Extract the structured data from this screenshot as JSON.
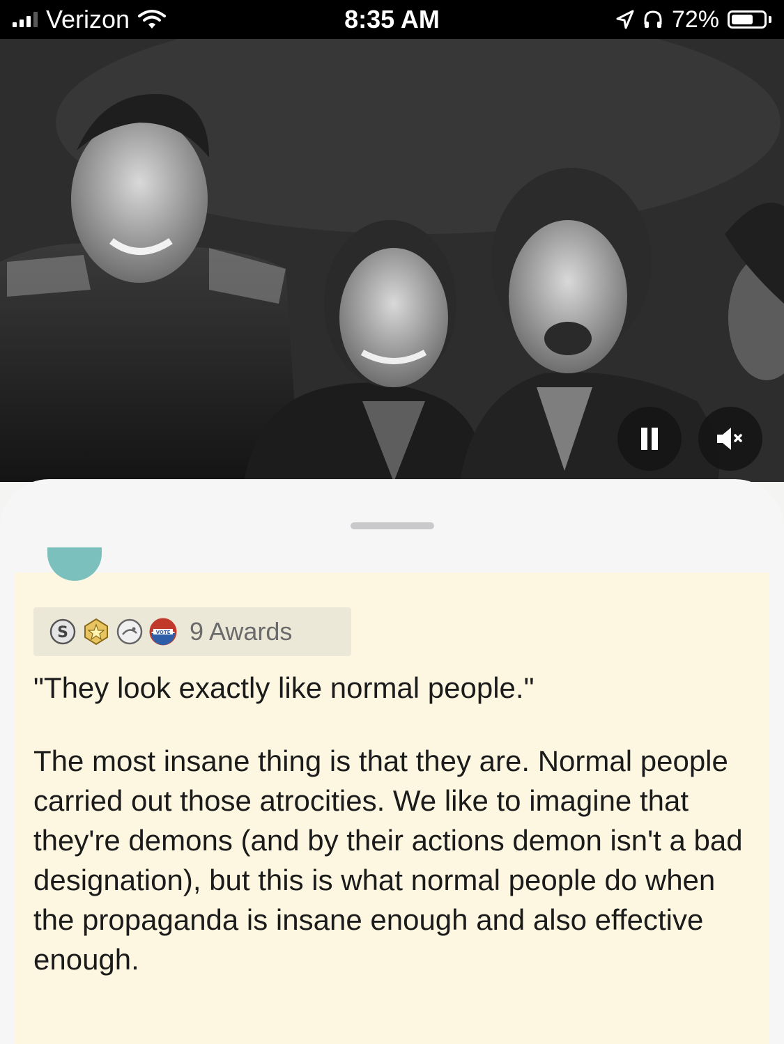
{
  "status_bar": {
    "carrier": "Verizon",
    "time": "8:35 AM",
    "battery_pct": "72%",
    "battery_level": 0.72,
    "icons": [
      "signal-icon",
      "wifi-icon",
      "location-icon",
      "headphones-icon",
      "battery-icon"
    ]
  },
  "video": {
    "controls": [
      "pause-icon",
      "mute-icon"
    ]
  },
  "comment": {
    "awards": {
      "icons": [
        "silver-award-icon",
        "gold-star-award-icon",
        "face-award-icon",
        "vote-award-icon"
      ],
      "label": "9 Awards"
    },
    "quote": "\"They look exactly like normal people.\"",
    "body": "The most insane thing is that they are.  Normal people carried out those atrocities.  We like to imagine that they're demons (and by their actions demon isn't a bad designation),  but this is what normal people do when the propaganda is insane enough and also effective enough."
  },
  "colors": {
    "status_bar_bg": "#000000",
    "sheet_bg": "#f6f6f7",
    "comment_bg": "#fdf7e1",
    "awards_bg": "#ece8d8"
  }
}
